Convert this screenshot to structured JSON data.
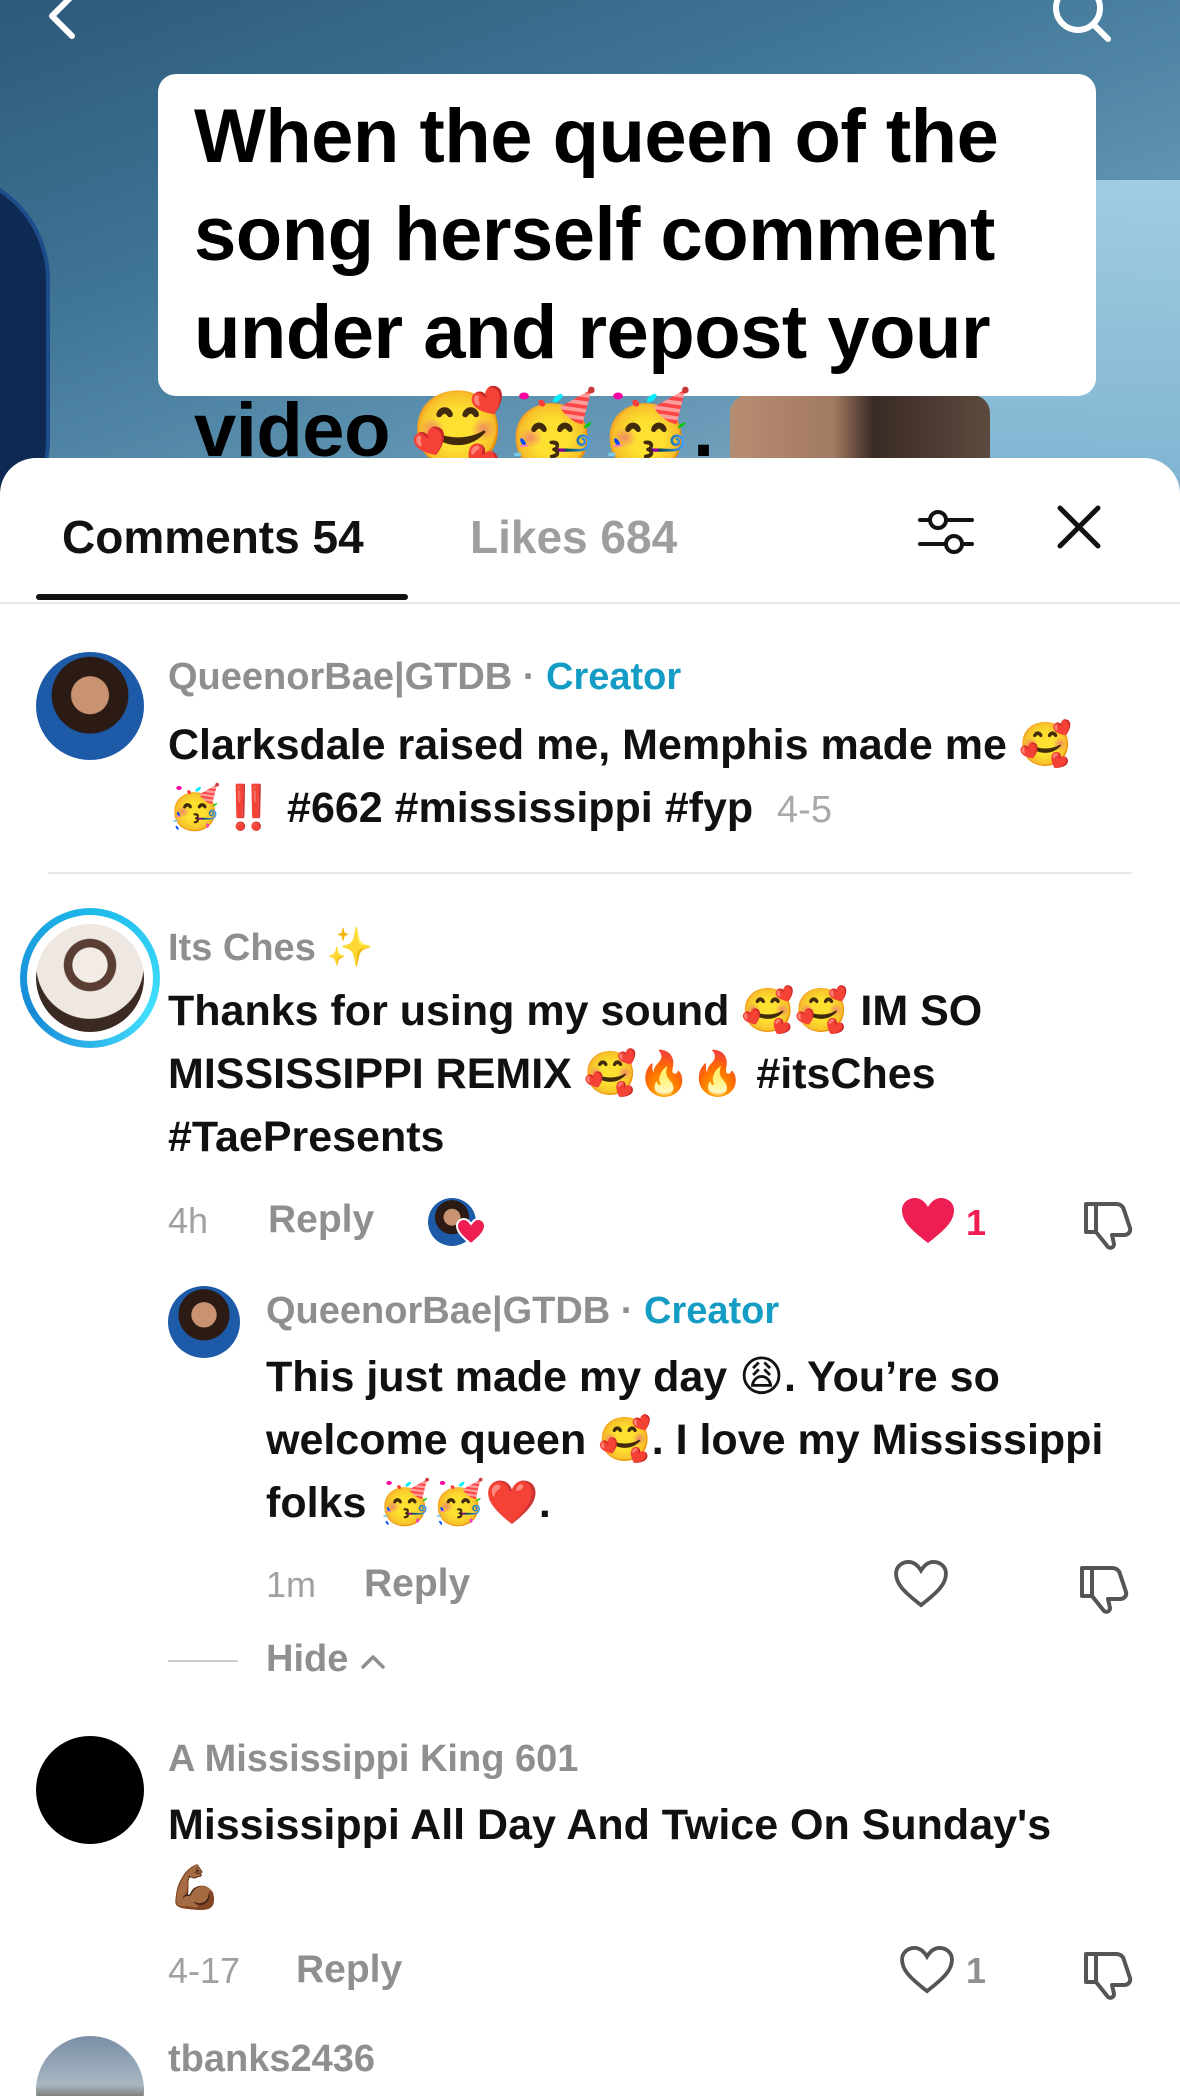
{
  "video": {
    "caption": "When the queen of the song herself comment under and repost your video 🥰🥳🥳."
  },
  "tabs": {
    "comments_label": "Comments 54",
    "likes_label": "Likes 684"
  },
  "comments": [
    {
      "username": "QueenorBae|GTDB",
      "separator": " · ",
      "badge": "Creator",
      "text": "Clarksdale raised me, Memphis made me 🥰🥳‼️ #662 #mississippi #fyp",
      "date": "4-5"
    },
    {
      "username": "Its Ches ✨",
      "text": "Thanks for using my sound 🥰🥰 IM SO MISSISSIPPI REMIX 🥰🔥🔥 #itsChes #TaePresents",
      "time": "4h",
      "reply_label": "Reply",
      "likes": "1",
      "reply": {
        "username": "QueenorBae|GTDB",
        "separator": " · ",
        "badge": "Creator",
        "text": "This just made my day 😩. You’re so welcome queen 🥰. I love my Mississippi folks 🥳🥳❤️.",
        "time": "1m",
        "reply_label": "Reply"
      },
      "hide_label": "Hide"
    },
    {
      "username": "A Mississippi King 601",
      "text": "Mississippi All Day And Twice On Sunday's 💪🏾",
      "time": "4-17",
      "reply_label": "Reply",
      "likes": "1"
    },
    {
      "username": "tbanks2436"
    }
  ],
  "icons": {
    "back": "chevron-left-icon",
    "search": "search-icon",
    "filter": "sliders-icon",
    "close": "close-icon",
    "like": "heart-icon",
    "dislike": "thumbs-down-icon"
  },
  "colors": {
    "creator_badge": "#159cc4",
    "liked_heart": "#ee1d52",
    "avatar_ring": "#1db9e8"
  }
}
